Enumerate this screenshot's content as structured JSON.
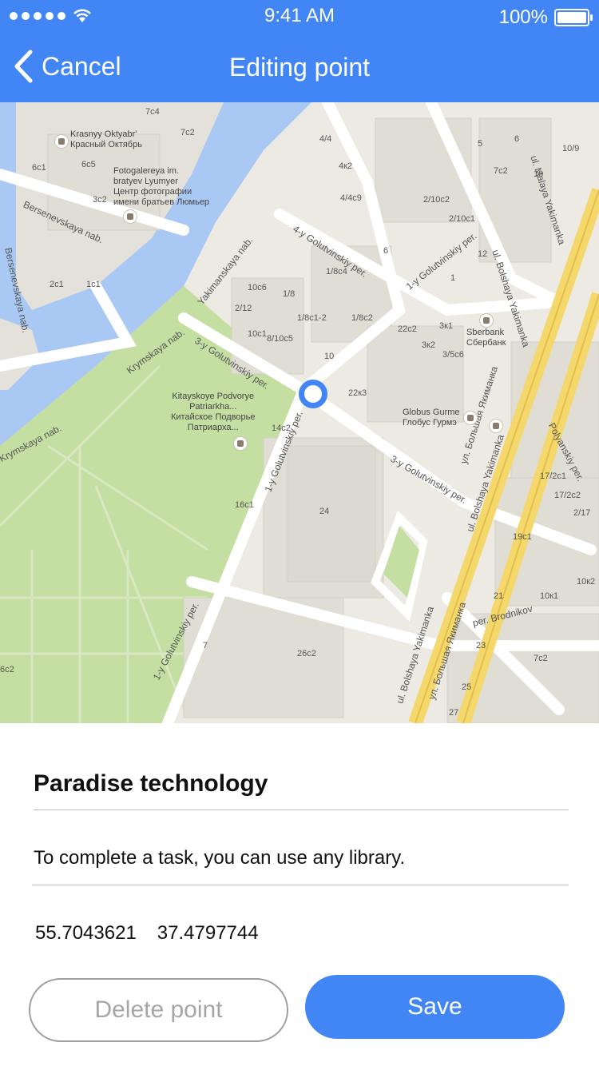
{
  "status": {
    "time": "9:41 AM",
    "battery": "100%"
  },
  "nav": {
    "back_label": "Cancel",
    "title": "Editing point"
  },
  "map": {
    "streets": [
      "Bersenevskaya nab.",
      "Bersenevskaya nab.",
      "Yakimanskaya nab.",
      "3-y Golutvinskiy per.",
      "4-y Golutvinskiy per.",
      "1-y Golutvinskiy per.",
      "Krymskaya nab.",
      "Krymskaya nab.",
      "1-y Golutvinskiy per.",
      "3-y Golutvinskiy per.",
      "ul. Malaya Yakimanka",
      "ul. Bolshaya Yakimanka",
      "ul. Bolshaya Yakimanka",
      "ул. Большая Якиманка",
      "ul. Bolshaya Yakimanka",
      "ул. Большая Якиманка",
      "Polyanskiy per.",
      "per. Brodnikov",
      "1-y Golutvinskiy per."
    ],
    "pois": [
      {
        "lines": [
          "Krasnyy Oktyabr'",
          "Красный Октябрь"
        ]
      },
      {
        "lines": [
          "Fotogalereya im.",
          "bratyev Lyumyer",
          "Центр фотографии",
          "имени братьев Люмьер"
        ]
      },
      {
        "lines": [
          "Kitayskoye Podvorye",
          "Patriarkha...",
          "Китайское Подворье",
          "Патриарха..."
        ]
      },
      {
        "lines": [
          "Sberbank",
          "Сбербанк"
        ]
      },
      {
        "lines": [
          "Globus Gurme",
          "Глобус Гурмэ"
        ]
      }
    ],
    "building_numbers": [
      "7c4",
      "7c2",
      "6c1",
      "6c5",
      "3c2",
      "2c1",
      "1c1",
      "4/4",
      "4к2",
      "4/4c9",
      "6",
      "2/10c2",
      "2/10c1",
      "12",
      "1",
      "10c6",
      "1/8c4",
      "2/12",
      "1/8",
      "1/8c1-2",
      "1/8c2",
      "10c1",
      "8/10c5",
      "10",
      "22c2",
      "3к1",
      "3к2",
      "3/5c6",
      "22к3",
      "14c2",
      "16c1",
      "24",
      "6",
      "5",
      "7c2",
      "10",
      "10/9",
      "17/2c1",
      "17/2c2",
      "2/17",
      "19c1",
      "21",
      "10к1",
      "10к2",
      "7c2",
      "23",
      "26c2",
      "7",
      "27",
      "25",
      "6c2"
    ]
  },
  "form": {
    "title": "Paradise technology",
    "description": "To complete a task, you can use any library.",
    "latitude": "55.7043621",
    "longitude": "37.4797744"
  },
  "buttons": {
    "delete_label": "Delete point",
    "save_label": "Save"
  },
  "colors": {
    "accent": "#4285f4",
    "water": "#a9c9f4",
    "park": "#c5dea1",
    "road_major": "#f5d86b",
    "map_bg": "#eceae3"
  }
}
